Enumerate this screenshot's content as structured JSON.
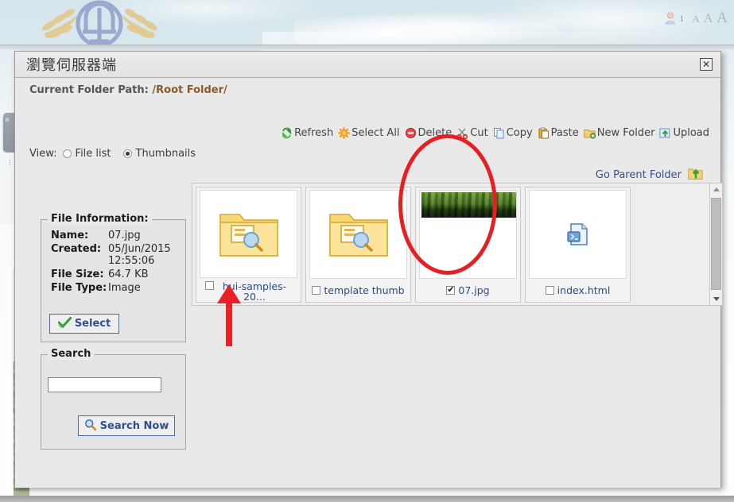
{
  "site": {
    "logo_alt": "government-emblem-logo",
    "user_count": "1",
    "font_sizes": [
      "A",
      "A",
      "A"
    ]
  },
  "dialog": {
    "title": "瀏覽伺服器端",
    "close_label": "✕",
    "path_label": "Current Folder Path:",
    "path_value": "/Root Folder/",
    "view_label": "View:",
    "view_options": [
      {
        "label": "File list",
        "selected": false
      },
      {
        "label": "Thumbnails",
        "selected": true
      }
    ],
    "toolbar": [
      {
        "label": "Refresh",
        "icon": "refresh-icon"
      },
      {
        "label": "Select All",
        "icon": "asterisk-icon"
      },
      {
        "label": "Delete",
        "icon": "delete-icon"
      },
      {
        "label": "Cut",
        "icon": "scissors-icon"
      },
      {
        "label": "Copy",
        "icon": "copy-icon"
      },
      {
        "label": "Paste",
        "icon": "paste-icon"
      },
      {
        "label": "New Folder",
        "icon": "new-folder-icon"
      },
      {
        "label": "Upload",
        "icon": "upload-icon"
      }
    ],
    "parent_folder": {
      "label": "Go Parent Folder",
      "icon": "up-folder-icon"
    }
  },
  "file_information": {
    "legend": "File Information:",
    "rows": [
      {
        "key": "Name:",
        "value": "07.jpg"
      },
      {
        "key": "Created:",
        "value": "05/Jun/2015 12:55:06"
      },
      {
        "key": "File Size:",
        "value": "64.7 KB"
      },
      {
        "key": "File Type:",
        "value": "Image"
      }
    ],
    "select_button": "Select"
  },
  "search": {
    "legend": "Search",
    "input_value": "",
    "placeholder": "",
    "button_label": "Search Now"
  },
  "thumbnails": [
    {
      "name": "hui-samples-20...",
      "type": "folder",
      "checked": false,
      "two_line": true
    },
    {
      "name": "template thumb",
      "type": "folder",
      "checked": false,
      "two_line": false
    },
    {
      "name": "07.jpg",
      "type": "image",
      "checked": true,
      "two_line": false
    },
    {
      "name": "index.html",
      "type": "html",
      "checked": false,
      "two_line": false
    }
  ],
  "annotations": {
    "ellipse_target": "07.jpg thumbnail",
    "arrow_target": "hui-samples-20... folder",
    "color": "#e61f23"
  },
  "colors": {
    "accent_link": "#2b4a86",
    "path_value": "#8a5a2b",
    "button_border": "#4a6fa5",
    "annotation_red": "#e61f23"
  }
}
